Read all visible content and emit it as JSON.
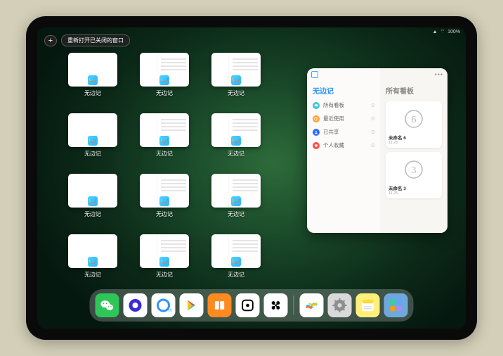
{
  "status": {
    "signal": "▲",
    "wifi": "⌔",
    "battery": "100%"
  },
  "topbar": {
    "plus_label": "+",
    "reopen_label": "重新打开已关闭的窗口"
  },
  "window_label": "无边记",
  "windows": [
    {
      "variant": "a"
    },
    {
      "variant": "b"
    },
    {
      "variant": "b"
    },
    {
      "variant": "a"
    },
    {
      "variant": "b"
    },
    {
      "variant": "b"
    },
    {
      "variant": "a"
    },
    {
      "variant": "b"
    },
    {
      "variant": "b"
    },
    {
      "variant": "a"
    },
    {
      "variant": "b"
    },
    {
      "variant": "b"
    }
  ],
  "panel": {
    "left_title": "无边记",
    "right_title": "所有看板",
    "rows": [
      {
        "icon": "cloud",
        "color": "#3fc6d8",
        "label": "所有看板",
        "count": 0
      },
      {
        "icon": "clock",
        "color": "#ff9f2e",
        "label": "最近使用",
        "count": 0
      },
      {
        "icon": "person",
        "color": "#2f6bff",
        "label": "已共享",
        "count": 0
      },
      {
        "icon": "heart",
        "color": "#ff4d4d",
        "label": "个人收藏",
        "count": 0
      }
    ],
    "cards": [
      {
        "glyph": "6",
        "name": "未命名 6",
        "time": "11:28"
      },
      {
        "glyph": "3",
        "name": "未命名 3",
        "time": "11:25"
      }
    ]
  },
  "dock": {
    "apps": [
      {
        "name": "wechat",
        "bg": "#2dc657",
        "glyph": "✱"
      },
      {
        "name": "quark",
        "bg": "#ffffff",
        "glyph": "◉"
      },
      {
        "name": "qqbrowser",
        "bg": "#ffffff",
        "glyph": "◯"
      },
      {
        "name": "play",
        "bg": "#ffffff",
        "glyph": "▶"
      },
      {
        "name": "books",
        "bg": "#ff8a1f",
        "glyph": "▯▯"
      },
      {
        "name": "die",
        "bg": "#ffffff",
        "glyph": "⊡"
      },
      {
        "name": "obsidian",
        "bg": "#ffffff",
        "glyph": "✱"
      },
      {
        "name": "freeform",
        "bg": "#ffffff",
        "glyph": "〰"
      },
      {
        "name": "settings",
        "bg": "#d9d9d9",
        "glyph": "⚙"
      },
      {
        "name": "notes",
        "bg": "#fff07a",
        "glyph": "≣"
      },
      {
        "name": "library",
        "bg": "#6fa8dc",
        "glyph": "⊞"
      }
    ]
  }
}
